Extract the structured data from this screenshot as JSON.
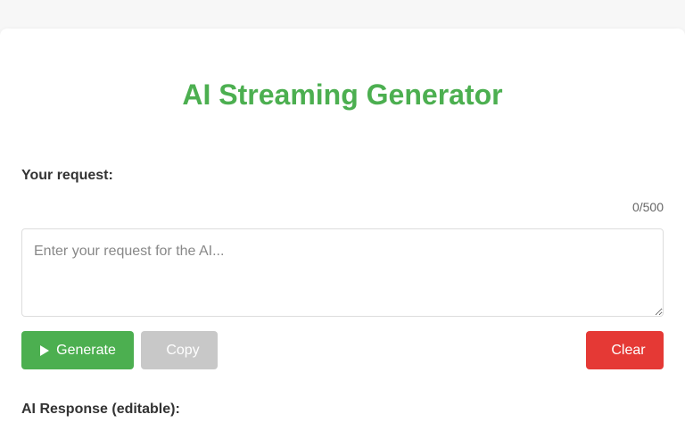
{
  "app": {
    "title": "AI Streaming Generator"
  },
  "request": {
    "label": "Your request:",
    "counter": "0/500",
    "value": "",
    "placeholder": "Enter your request for the AI..."
  },
  "buttons": {
    "generate_label": "Generate",
    "generate_icon": "play-icon",
    "copy_label": "Copy",
    "copy_icon_glyph": "",
    "copy_disabled": true,
    "clear_label": "Clear",
    "clear_icon_glyph": ""
  },
  "response": {
    "label": "AI Response (editable):"
  },
  "colors": {
    "accent": "#4caf50",
    "danger": "#e53935",
    "disabled": "#c8c8c8"
  }
}
